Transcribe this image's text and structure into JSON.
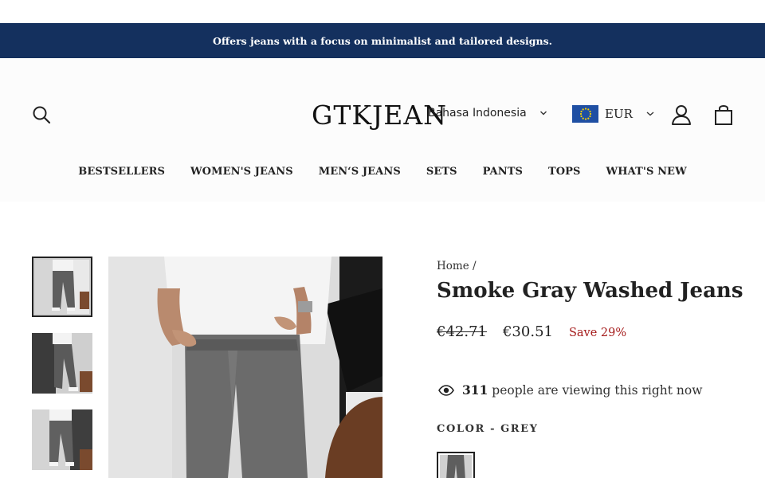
{
  "announcement": "Offers jeans with a focus on minimalist and tailored designs.",
  "header": {
    "logo": "GTKJEAN",
    "language": "Bahasa Indonesia",
    "currency": "EUR",
    "icons": [
      "search-icon",
      "flag-eu-icon",
      "account-icon",
      "cart-icon"
    ]
  },
  "nav": [
    "BESTSELLERS",
    "WOMEN'S JEANS",
    "MEN‘S JEANS",
    "SETS",
    "PANTS",
    "TOPS",
    "WHAT'S NEW"
  ],
  "product": {
    "breadcrumb_home": "Home",
    "breadcrumb_sep": "/",
    "title": "Smoke Gray Washed Jeans",
    "old_price": "€42.71",
    "price": "€30.51",
    "save": "Save 29%",
    "viewing_count": "311",
    "viewing_text": "people are viewing this right now",
    "color_label": "COLOR -",
    "color_value": "GREY"
  },
  "colors": {
    "announcement_bg": "#14305e",
    "save_text": "#a51b1b"
  }
}
